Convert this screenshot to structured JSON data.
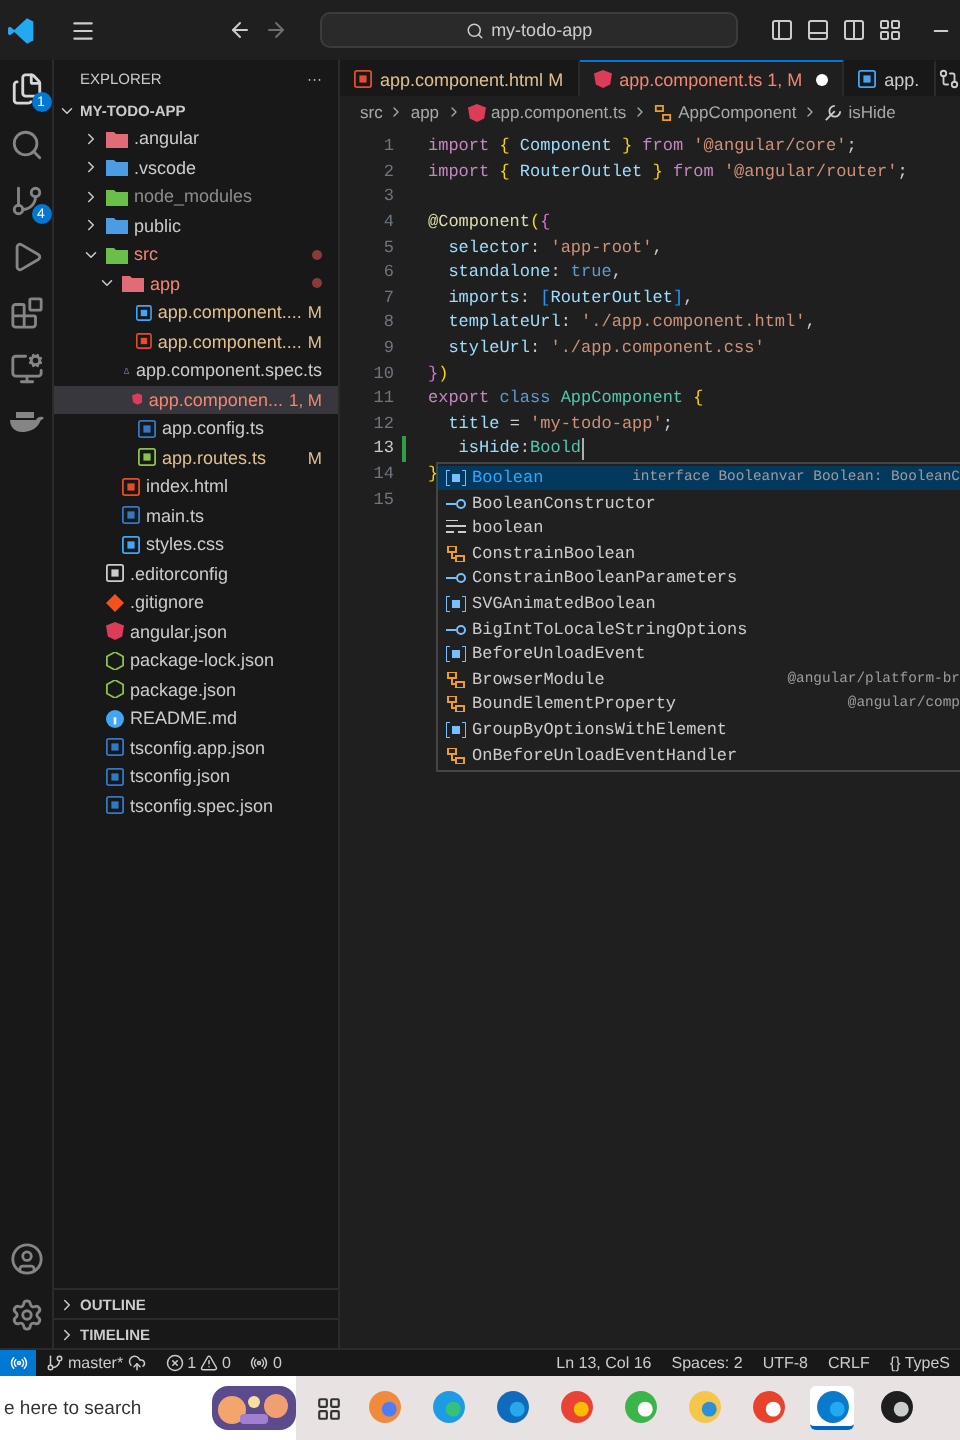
{
  "title_bar": {
    "search": "my-todo-app"
  },
  "activity_bar": {
    "explorer_badge": "1",
    "source_control_badge": "4"
  },
  "sidebar": {
    "title": "EXPLORER",
    "more": "···",
    "root": "MY-TODO-APP",
    "tree": [
      {
        "name": ".angular",
        "kind": "redfolder",
        "color": "#cccccc",
        "expanded": false
      },
      {
        "name": ".vscode",
        "kind": "bluefolder",
        "color": "#cccccc",
        "expanded": false
      },
      {
        "name": "node_modules",
        "kind": "greenfolder",
        "color": "#8c8c8c",
        "expanded": false
      },
      {
        "name": "public",
        "kind": "bluefolder",
        "color": "#cccccc",
        "expanded": false
      },
      {
        "name": "src",
        "kind": "greenfolder",
        "color": "#f48771",
        "expanded": true,
        "problem_dot": true,
        "children": [
          {
            "name": "app",
            "kind": "redfolder",
            "color": "#f48771",
            "expanded": true,
            "problem_dot": true,
            "children": [
              {
                "name": "app.component....",
                "kind": "css",
                "color": "#e2c08d",
                "status": "M",
                "selected": false
              },
              {
                "name": "app.component....",
                "kind": "html",
                "color": "#e2c08d",
                "status": "M",
                "selected": false
              },
              {
                "name": "app.component.spec.ts",
                "kind": "test",
                "color": "#cccccc",
                "selected": false
              },
              {
                "name": "app.componen...",
                "kind": "angular",
                "color": "#f48771",
                "status": "1, M",
                "selected": true
              },
              {
                "name": "app.config.ts",
                "kind": "ts",
                "color": "#cccccc",
                "selected": false
              },
              {
                "name": "app.routes.ts",
                "kind": "routes",
                "color": "#e2c08d",
                "status": "M",
                "selected": false
              }
            ]
          },
          {
            "name": "index.html",
            "kind": "html",
            "color": "#cccccc",
            "selected": false
          },
          {
            "name": "main.ts",
            "kind": "ts",
            "color": "#cccccc",
            "selected": false
          },
          {
            "name": "styles.css",
            "kind": "css",
            "color": "#cccccc",
            "selected": false
          }
        ]
      },
      {
        "name": ".editorconfig",
        "kind": "config",
        "color": "#cccccc",
        "selected": false
      },
      {
        "name": ".gitignore",
        "kind": "git",
        "color": "#cccccc",
        "selected": false
      },
      {
        "name": "angular.json",
        "kind": "angular",
        "color": "#cccccc",
        "selected": false
      },
      {
        "name": "package-lock.json",
        "kind": "npm",
        "color": "#cccccc",
        "selected": false
      },
      {
        "name": "package.json",
        "kind": "npm",
        "color": "#cccccc",
        "selected": false
      },
      {
        "name": "README.md",
        "kind": "info",
        "color": "#cccccc",
        "selected": false
      },
      {
        "name": "tsconfig.app.json",
        "kind": "ts",
        "color": "#cccccc",
        "selected": false
      },
      {
        "name": "tsconfig.json",
        "kind": "ts",
        "color": "#cccccc",
        "selected": false
      },
      {
        "name": "tsconfig.spec.json",
        "kind": "ts",
        "color": "#cccccc",
        "selected": false
      }
    ],
    "sections": [
      {
        "label": "OUTLINE",
        "expanded": false
      },
      {
        "label": "TIMELINE",
        "expanded": false
      }
    ]
  },
  "tabs": [
    {
      "label": "app.component.html",
      "status": "M",
      "kind": "html",
      "color": "#e2c08d",
      "selected": false,
      "dirty": false
    },
    {
      "label": "app.component.ts",
      "status": "1, M",
      "kind": "angular",
      "color": "#f48771",
      "selected": true,
      "dirty": true
    },
    {
      "label": "app.",
      "kind": "css",
      "color": "#cccccc",
      "selected": false,
      "dirty": false
    }
  ],
  "breadcrumb": [
    {
      "label": "src",
      "kind": "folder"
    },
    {
      "label": "app",
      "kind": "folder"
    },
    {
      "label": "app.component.ts",
      "kind": "angular"
    },
    {
      "label": "AppComponent",
      "kind": "class"
    },
    {
      "label": "isHide",
      "kind": "property"
    }
  ],
  "code": [
    {
      "number": "1",
      "active": false,
      "tokens": [
        {
          "t": "import",
          "kind": "kw"
        },
        {
          "t": " { ",
          "kind": "br"
        },
        {
          "t": "Component",
          "kind": "prop"
        },
        {
          "t": " } ",
          "kind": "br"
        },
        {
          "t": "from",
          "kind": "kw"
        },
        {
          "t": " '@angular/core'",
          "kind": "str"
        },
        {
          "t": ";",
          "kind": "punct"
        }
      ]
    },
    {
      "number": "2",
      "active": false,
      "tokens": [
        {
          "t": "import",
          "kind": "kw"
        },
        {
          "t": " { ",
          "kind": "br"
        },
        {
          "t": "RouterOutlet",
          "kind": "prop"
        },
        {
          "t": " } ",
          "kind": "br"
        },
        {
          "t": "from",
          "kind": "kw"
        },
        {
          "t": " '@angular/router'",
          "kind": "str"
        },
        {
          "t": ";",
          "kind": "punct"
        }
      ]
    },
    {
      "number": "3",
      "active": false
    },
    {
      "number": "4",
      "active": false,
      "tokens": [
        {
          "t": "@Component",
          "kind": "fn"
        },
        {
          "t": "(",
          "kind": "br"
        },
        {
          "t": "{",
          "kind": "br2"
        }
      ]
    },
    {
      "number": "5",
      "active": false,
      "tokens": [
        {
          "t": "  selector",
          "kind": "prop"
        },
        {
          "t": ": ",
          "kind": "punct"
        },
        {
          "t": "'app-root'",
          "kind": "str"
        },
        {
          "t": ",",
          "kind": "punct"
        }
      ]
    },
    {
      "number": "6",
      "active": false,
      "tokens": [
        {
          "t": "  standalone",
          "kind": "prop"
        },
        {
          "t": ": ",
          "kind": "punct"
        },
        {
          "t": "true",
          "kind": "kw2"
        },
        {
          "t": ",",
          "kind": "punct"
        }
      ]
    },
    {
      "number": "7",
      "active": false,
      "tokens": [
        {
          "t": "  imports",
          "kind": "prop"
        },
        {
          "t": ": ",
          "kind": "punct"
        },
        {
          "t": "[",
          "kind": "br3"
        },
        {
          "t": "RouterOutlet",
          "kind": "prop"
        },
        {
          "t": "]",
          "kind": "br3"
        },
        {
          "t": ",",
          "kind": "punct"
        }
      ]
    },
    {
      "number": "8",
      "active": false,
      "tokens": [
        {
          "t": "  templateUrl",
          "kind": "prop"
        },
        {
          "t": ": ",
          "kind": "punct"
        },
        {
          "t": "'./app.component.html'",
          "kind": "str"
        },
        {
          "t": ",",
          "kind": "punct"
        }
      ]
    },
    {
      "number": "9",
      "active": false,
      "tokens": [
        {
          "t": "  styleUrl",
          "kind": "prop"
        },
        {
          "t": ": ",
          "kind": "punct"
        },
        {
          "t": "'./app.component.css'",
          "kind": "str"
        }
      ]
    },
    {
      "number": "10",
      "active": false,
      "tokens": [
        {
          "t": "}",
          "kind": "br2"
        },
        {
          "t": ")",
          "kind": "br"
        }
      ]
    },
    {
      "number": "11",
      "active": false,
      "tokens": [
        {
          "t": "export",
          "kind": "kw"
        },
        {
          "t": " class ",
          "kind": "kw2"
        },
        {
          "t": "AppComponent",
          "kind": "type"
        },
        {
          "t": " {",
          "kind": "br"
        }
      ]
    },
    {
      "number": "12",
      "active": false,
      "tokens": [
        {
          "t": "  title",
          "kind": "prop"
        },
        {
          "t": " = ",
          "kind": "punct"
        },
        {
          "t": "'my-todo-app'",
          "kind": "str"
        },
        {
          "t": ";",
          "kind": "punct"
        }
      ]
    },
    {
      "number": "13",
      "active": true,
      "tokens": [
        {
          "t": "   isHide",
          "kind": "prop"
        },
        {
          "t": ":",
          "kind": "punct"
        },
        {
          "t": "Boold",
          "kind": "type"
        }
      ]
    },
    {
      "number": "14",
      "active": false,
      "tokens": [
        {
          "t": "}",
          "kind": "br"
        }
      ]
    },
    {
      "number": "15",
      "active": false
    }
  ],
  "suggestions": [
    {
      "kind": "variable",
      "selected": true,
      "label": "Boolean",
      "detail": "interface Booleanvar Boolean: BooleanC"
    },
    {
      "kind": "interface",
      "selected": false,
      "label": "BooleanConstructor"
    },
    {
      "kind": "keyword",
      "selected": false,
      "label": "boolean"
    },
    {
      "kind": "class",
      "selected": false,
      "label": "ConstrainBoolean"
    },
    {
      "kind": "interface",
      "selected": false,
      "label": "ConstrainBooleanParameters"
    },
    {
      "kind": "variable",
      "selected": false,
      "label": "SVGAnimatedBoolean"
    },
    {
      "kind": "interface",
      "selected": false,
      "label": "BigIntToLocaleStringOptions"
    },
    {
      "kind": "variable",
      "selected": false,
      "label": "BeforeUnloadEvent"
    },
    {
      "kind": "class",
      "selected": false,
      "label": "BrowserModule",
      "detail": "@angular/platform-br"
    },
    {
      "kind": "class",
      "selected": false,
      "label": "BoundElementProperty",
      "detail": "@angular/comp"
    },
    {
      "kind": "variable",
      "selected": false,
      "label": "GroupByOptionsWithElement"
    },
    {
      "kind": "class",
      "selected": false,
      "label": "OnBeforeUnloadEventHandler"
    }
  ],
  "status_bar": {
    "branch": "master*",
    "errors": "1",
    "warnings": "0",
    "ports": "0",
    "right": [
      "Ln 13, Col 16",
      "Spaces: 2",
      "UTF-8",
      "CRLF",
      "{} TypeS"
    ]
  },
  "taskbar": {
    "search": "e here to search",
    "apps": [
      {
        "kind": "copilot",
        "selected": false
      },
      {
        "kind": "edge",
        "selected": false
      },
      {
        "kind": "outlook",
        "selected": false
      },
      {
        "kind": "chrome",
        "selected": false
      },
      {
        "kind": "camtasia",
        "selected": false
      },
      {
        "kind": "explorer",
        "selected": false
      },
      {
        "kind": "wps",
        "selected": false
      },
      {
        "kind": "vscode",
        "selected": true
      },
      {
        "kind": "terminal",
        "selected": false
      }
    ]
  }
}
